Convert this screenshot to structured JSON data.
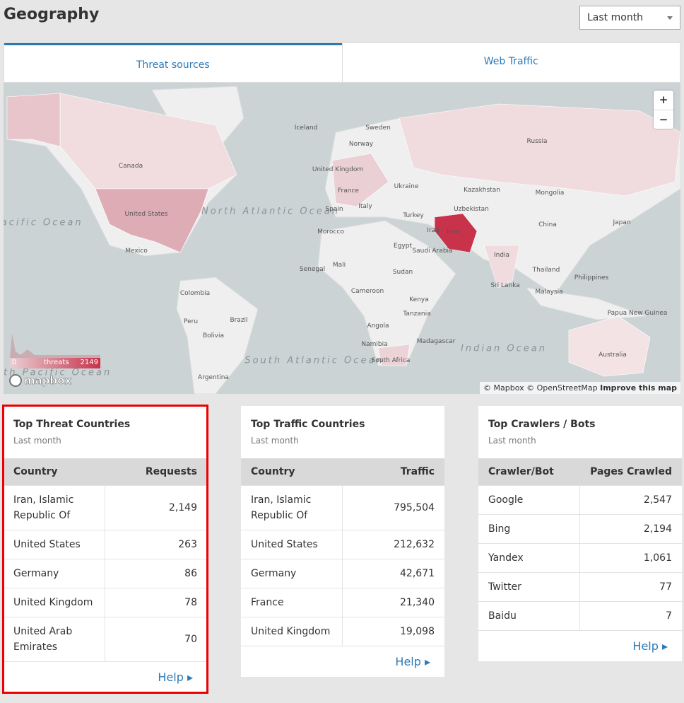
{
  "header": {
    "title": "Geography",
    "period_select": "Last month"
  },
  "tabs": [
    {
      "label": "Threat sources",
      "active": true
    },
    {
      "label": "Web Traffic",
      "active": false
    }
  ],
  "map": {
    "zoom_in": "+",
    "zoom_out": "−",
    "legend": {
      "min": "0",
      "label": "threats",
      "max": "2149",
      "color_low": "#e8cfd3",
      "color_high": "#c8324a"
    },
    "logo": "mapbox",
    "attribution": {
      "mapbox": "© Mapbox",
      "osm": "© OpenStreetMap",
      "improve": "Improve this map"
    },
    "oceans": [
      "North Atlantic Ocean",
      "North Pacific Ocean",
      "South Atlantic Ocean",
      "Indian Ocean",
      "South Pacific Ocean"
    ],
    "countries": [
      "Iceland",
      "Sweden",
      "Norway",
      "Russia",
      "Canada",
      "United Kingdom",
      "France",
      "Ukraine",
      "Kazakhstan",
      "Mongolia",
      "Spain",
      "Italy",
      "Turkey",
      "Uzbekistan",
      "Japan",
      "United States",
      "China",
      "Iraq",
      "Iran",
      "Morocco",
      "Egypt",
      "Saudi Arabia",
      "Mexico",
      "India",
      "Mali",
      "Senegal",
      "Sudan",
      "Thailand",
      "Philippines",
      "Cameroon",
      "Kenya",
      "Sri Lanka",
      "Malaysia",
      "Colombia",
      "Tanzania",
      "Peru",
      "Brazil",
      "Angola",
      "Papua New Guinea",
      "Bolivia",
      "Madagascar",
      "Namibia",
      "Australia",
      "South Africa",
      "Argentina"
    ]
  },
  "cards": [
    {
      "title": "Top Threat Countries",
      "subtitle": "Last month",
      "columns": [
        "Country",
        "Requests"
      ],
      "rows": [
        [
          "Iran, Islamic Republic Of",
          "2,149"
        ],
        [
          "United States",
          "263"
        ],
        [
          "Germany",
          "86"
        ],
        [
          "United Kingdom",
          "78"
        ],
        [
          "United Arab Emirates",
          "70"
        ]
      ],
      "help": "Help ▸"
    },
    {
      "title": "Top Traffic Countries",
      "subtitle": "Last month",
      "columns": [
        "Country",
        "Traffic"
      ],
      "rows": [
        [
          "Iran, Islamic Republic Of",
          "795,504"
        ],
        [
          "United States",
          "212,632"
        ],
        [
          "Germany",
          "42,671"
        ],
        [
          "France",
          "21,340"
        ],
        [
          "United Kingdom",
          "19,098"
        ]
      ],
      "help": "Help ▸"
    },
    {
      "title": "Top Crawlers / Bots",
      "subtitle": "Last month",
      "columns": [
        "Crawler/Bot",
        "Pages Crawled"
      ],
      "rows": [
        [
          "Google",
          "2,547"
        ],
        [
          "Bing",
          "2,194"
        ],
        [
          "Yandex",
          "1,061"
        ],
        [
          "Twitter",
          "77"
        ],
        [
          "Baidu",
          "7"
        ]
      ],
      "help": "Help ▸"
    }
  ]
}
